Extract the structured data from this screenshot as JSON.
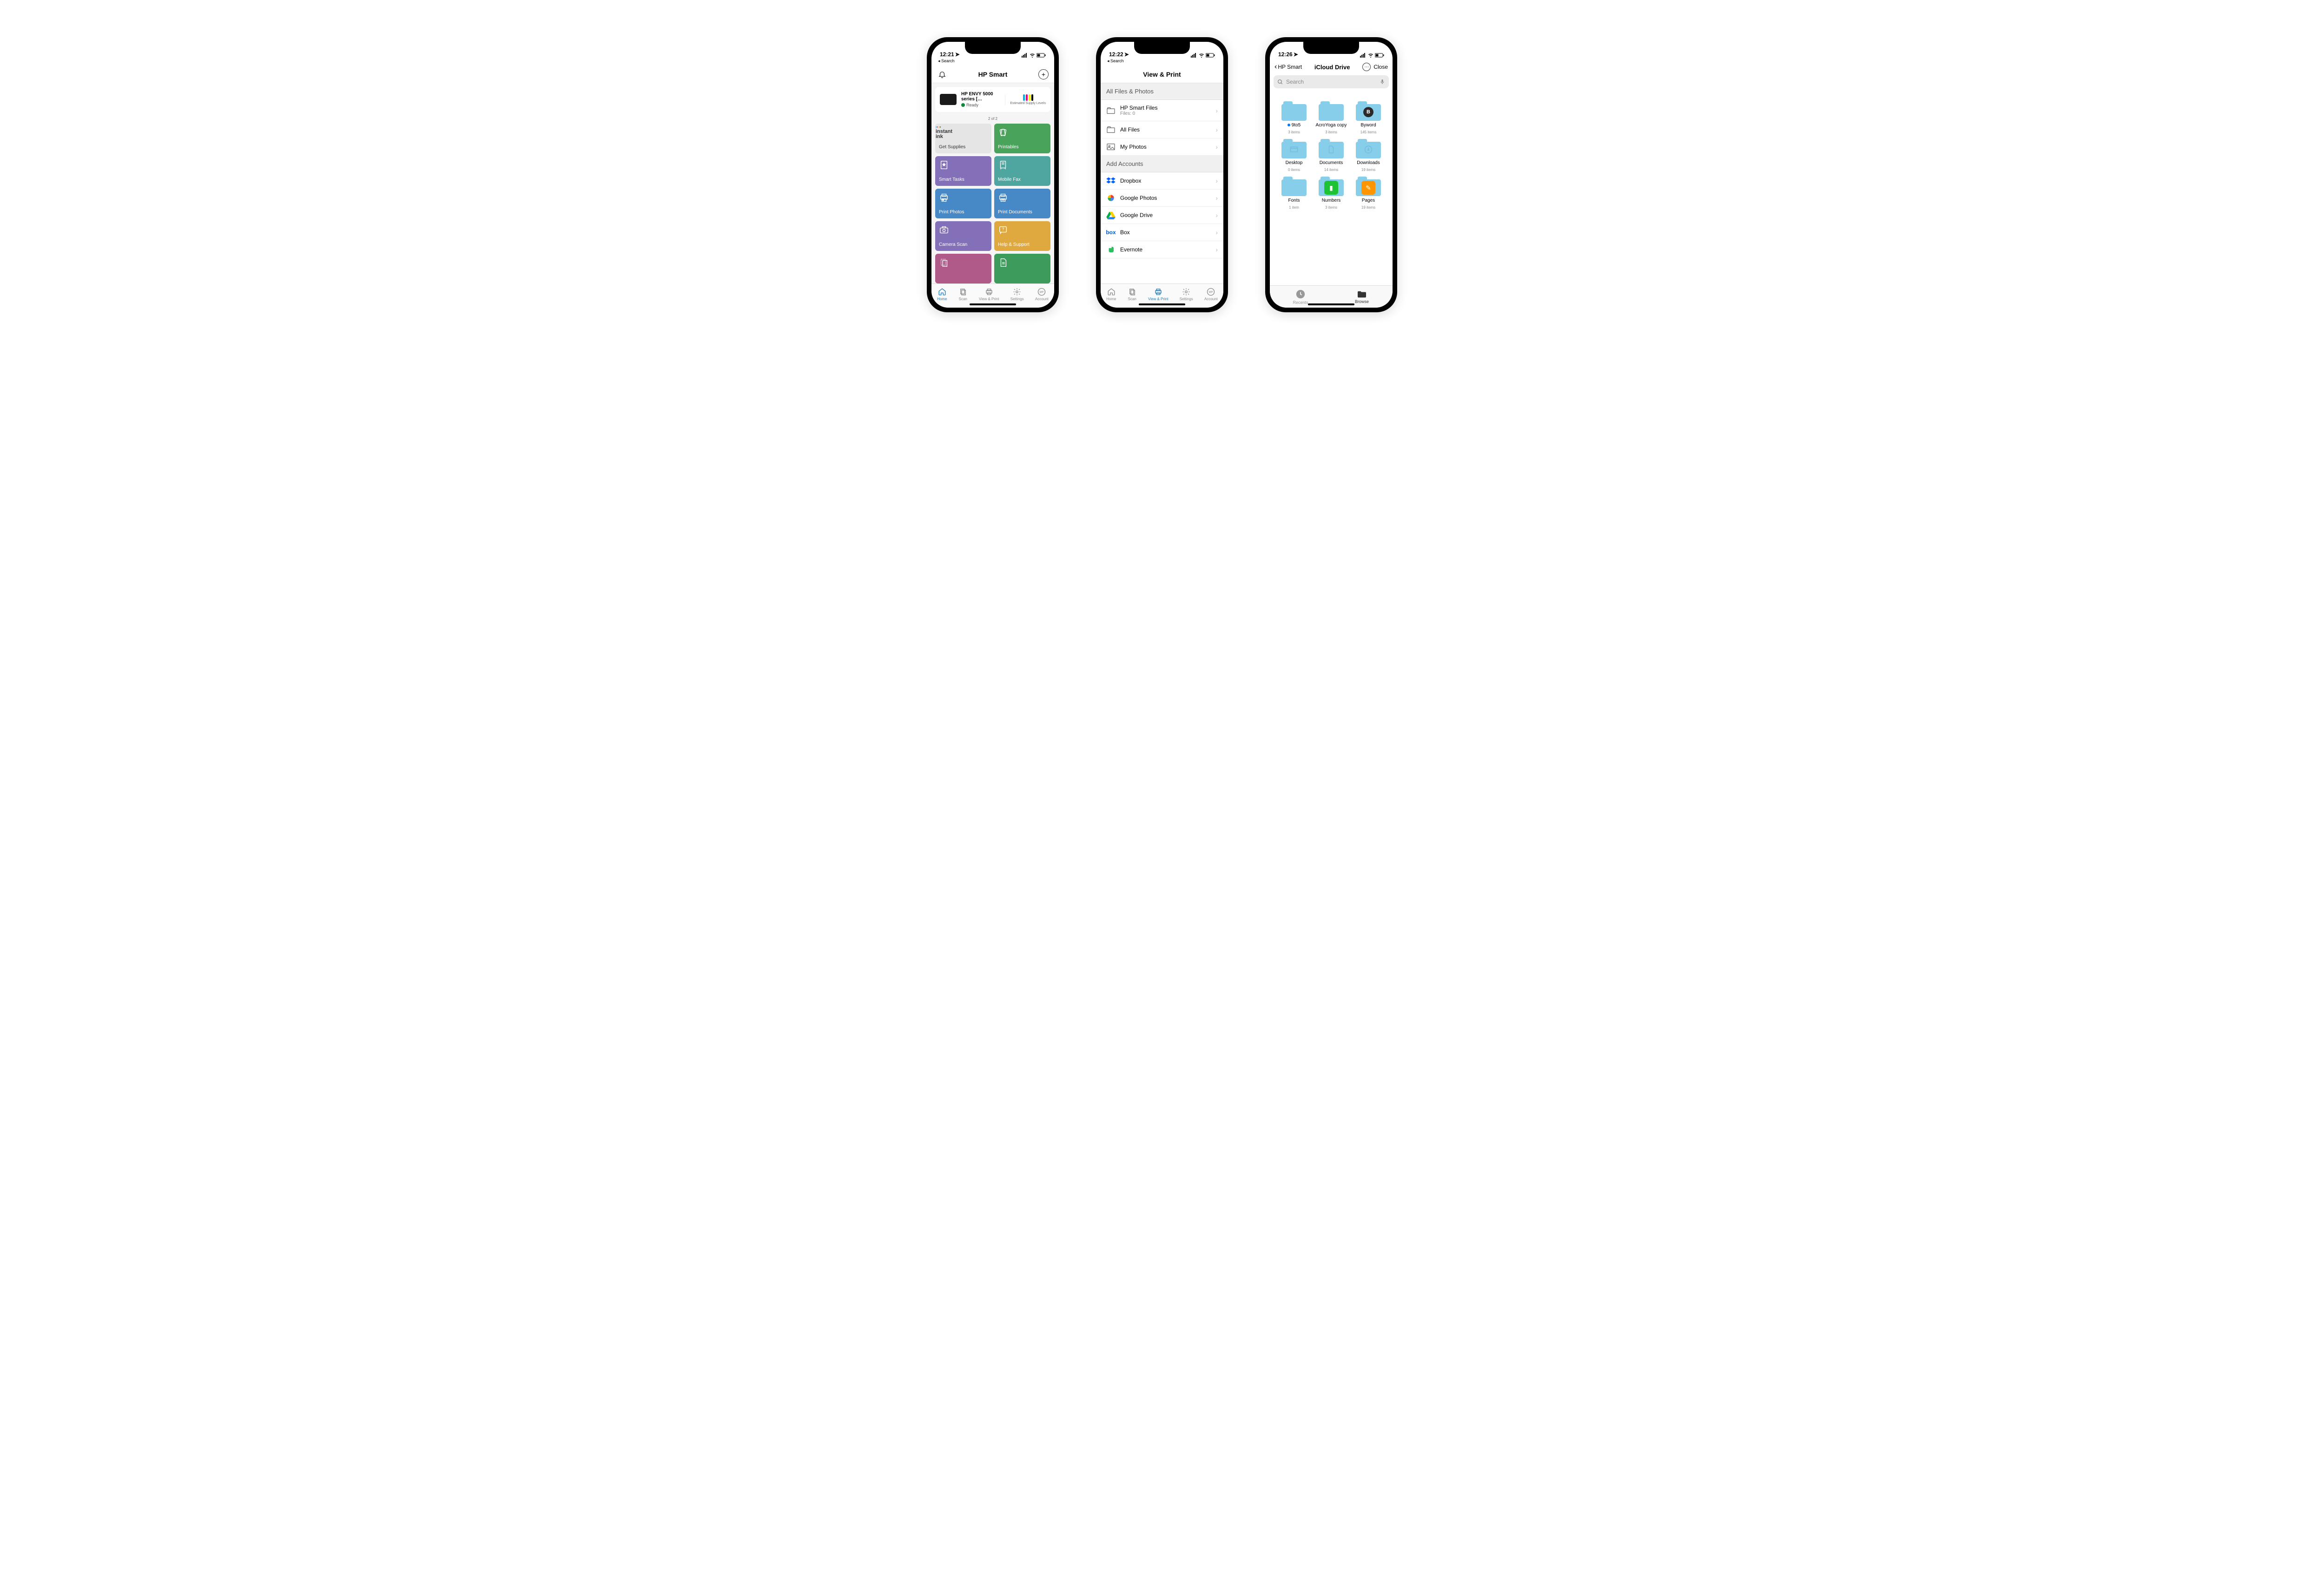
{
  "phone1": {
    "status": {
      "time": "12:21",
      "back": "◂ Search"
    },
    "header": {
      "title": "HP Smart"
    },
    "printer": {
      "name": "HP ENVY 5000 series […",
      "status": "Ready",
      "supply_label": "Estimated Supply Levels",
      "ink_colors": [
        "#00aeef",
        "#ec008c",
        "#fff200",
        "#000"
      ]
    },
    "pager": "2 of 2",
    "tiles": [
      {
        "label": "Get Supplies",
        "color": "tile-grey",
        "icon": "instant-ink"
      },
      {
        "label": "Printables",
        "color": "tile-green",
        "icon": "cards"
      },
      {
        "label": "Smart Tasks",
        "color": "tile-purple",
        "icon": "star-doc"
      },
      {
        "label": "Mobile Fax",
        "color": "tile-teal",
        "icon": "fax"
      },
      {
        "label": "Print Photos",
        "color": "tile-blue",
        "icon": "print-photo"
      },
      {
        "label": "Print Documents",
        "color": "tile-blue",
        "icon": "print-doc"
      },
      {
        "label": "Camera Scan",
        "color": "tile-purple",
        "icon": "camera"
      },
      {
        "label": "Help & Support",
        "color": "tile-orange",
        "icon": "help"
      },
      {
        "label": "",
        "color": "tile-magenta",
        "icon": "copy"
      },
      {
        "label": "",
        "color": "tile-green2",
        "icon": "doc"
      }
    ],
    "tabs": [
      {
        "label": "Home",
        "active": true
      },
      {
        "label": "Scan",
        "active": false
      },
      {
        "label": "View & Print",
        "active": false
      },
      {
        "label": "Settings",
        "active": false
      },
      {
        "label": "Account",
        "active": false
      }
    ]
  },
  "phone2": {
    "status": {
      "time": "12:22",
      "back": "◂ Search"
    },
    "header": {
      "title": "View & Print"
    },
    "section1": "All Files & Photos",
    "list1": [
      {
        "title": "HP Smart Files",
        "sub": "Files: 0",
        "icon": "folder"
      },
      {
        "title": "All Files",
        "icon": "folder"
      },
      {
        "title": "My Photos",
        "icon": "photo"
      }
    ],
    "section2": "Add Accounts",
    "list2": [
      {
        "title": "Dropbox",
        "icon": "dropbox"
      },
      {
        "title": "Google Photos",
        "icon": "gphotos"
      },
      {
        "title": "Google Drive",
        "icon": "gdrive"
      },
      {
        "title": "Box",
        "icon": "box"
      },
      {
        "title": "Evernote",
        "icon": "evernote"
      }
    ],
    "tabs": [
      {
        "label": "Home",
        "active": false
      },
      {
        "label": "Scan",
        "active": false
      },
      {
        "label": "View & Print",
        "active": true
      },
      {
        "label": "Settings",
        "active": false
      },
      {
        "label": "Account",
        "active": false
      }
    ]
  },
  "phone3": {
    "status": {
      "time": "12:26",
      "back": ""
    },
    "nav": {
      "back": "HP Smart",
      "title": "iCloud Drive",
      "close": "Close"
    },
    "search_placeholder": "Search",
    "folders": [
      {
        "name": "9to5",
        "meta": "3 items",
        "dot": true
      },
      {
        "name": "AcroYoga copy",
        "meta": "3 items"
      },
      {
        "name": "Byword",
        "meta": "145 items",
        "badge": "B"
      },
      {
        "name": "Desktop",
        "meta": "0 items",
        "inner": "window"
      },
      {
        "name": "Documents",
        "meta": "14 items",
        "inner": "doc"
      },
      {
        "name": "Downloads",
        "meta": "19 items",
        "inner": "download"
      },
      {
        "name": "Fonts",
        "meta": "1 item"
      },
      {
        "name": "Numbers",
        "meta": "3 items",
        "app": "numbers"
      },
      {
        "name": "Pages",
        "meta": "19 items",
        "app": "pages"
      }
    ],
    "tabs": [
      {
        "label": "Recents",
        "active": false
      },
      {
        "label": "Browse",
        "active": true
      }
    ]
  }
}
